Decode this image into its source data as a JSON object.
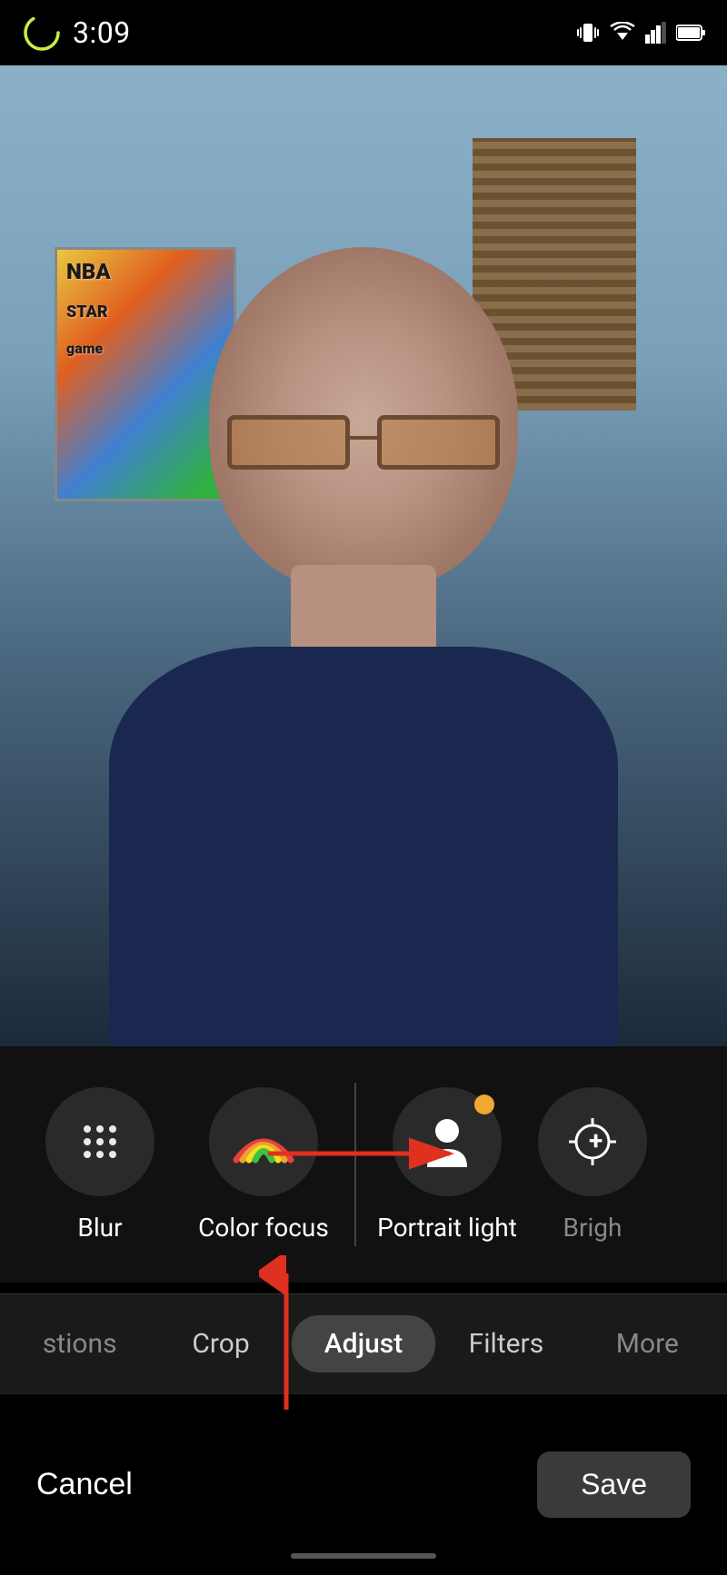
{
  "statusBar": {
    "time": "3:09"
  },
  "photo": {
    "altText": "Person portrait photo in home office"
  },
  "filterTools": {
    "items": [
      {
        "id": "blur",
        "label": "Blur",
        "icon": "blur-icon",
        "hasDot": false
      },
      {
        "id": "color-focus",
        "label": "Color focus",
        "icon": "color-focus-icon",
        "hasDot": false
      },
      {
        "id": "portrait-light",
        "label": "Portrait light",
        "icon": "portrait-light-icon",
        "hasDot": true
      },
      {
        "id": "brightness",
        "label": "Brigh",
        "icon": "brightness-icon",
        "hasDot": false
      }
    ]
  },
  "editTabs": {
    "items": [
      {
        "id": "suggestions",
        "label": "stions",
        "active": false
      },
      {
        "id": "crop",
        "label": "Crop",
        "active": false
      },
      {
        "id": "adjust",
        "label": "Adjust",
        "active": true
      },
      {
        "id": "filters",
        "label": "Filters",
        "active": false
      },
      {
        "id": "more",
        "label": "More",
        "active": false
      }
    ]
  },
  "bottomActions": {
    "cancelLabel": "Cancel",
    "saveLabel": "Save"
  }
}
